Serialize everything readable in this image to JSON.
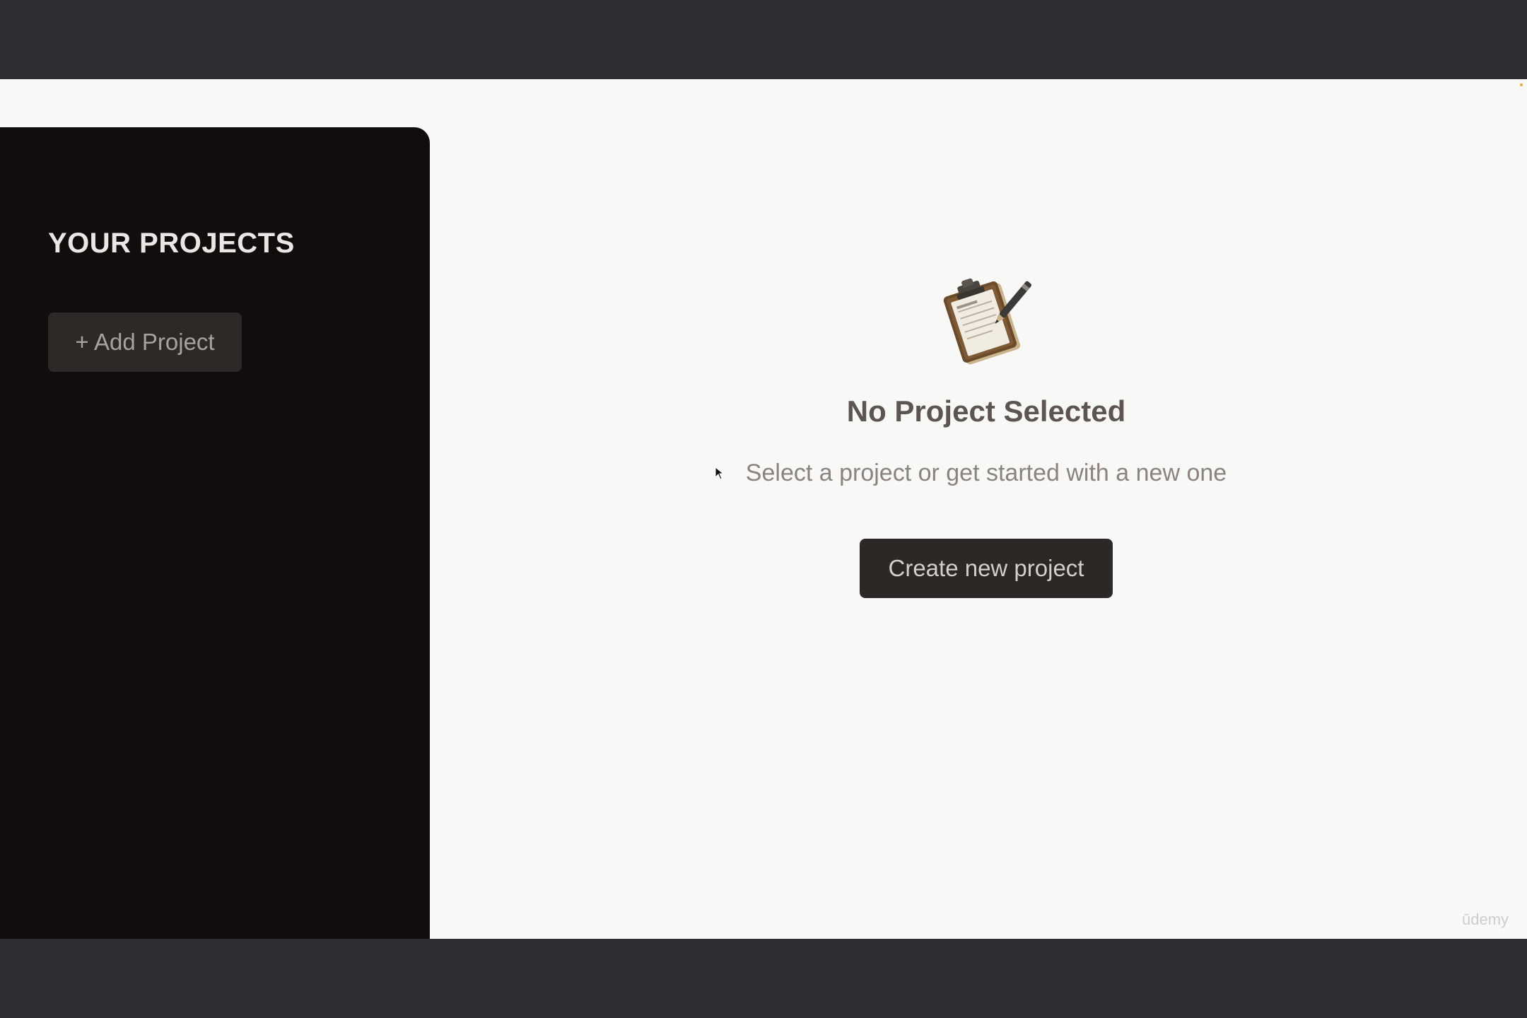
{
  "sidebar": {
    "title": "YOUR PROJECTS",
    "add_button_label": "+ Add Project"
  },
  "main": {
    "icon": "clipboard-pen-icon",
    "heading": "No Project Selected",
    "subtext": "Select a project or get started with a new one",
    "create_button_label": "Create new project"
  },
  "watermark": "ūdemy",
  "colors": {
    "sidebar_bg": "#110d0c",
    "main_bg": "#f8f8f7",
    "letterbox": "#2e2f32",
    "button_dark": "#2c2826"
  }
}
